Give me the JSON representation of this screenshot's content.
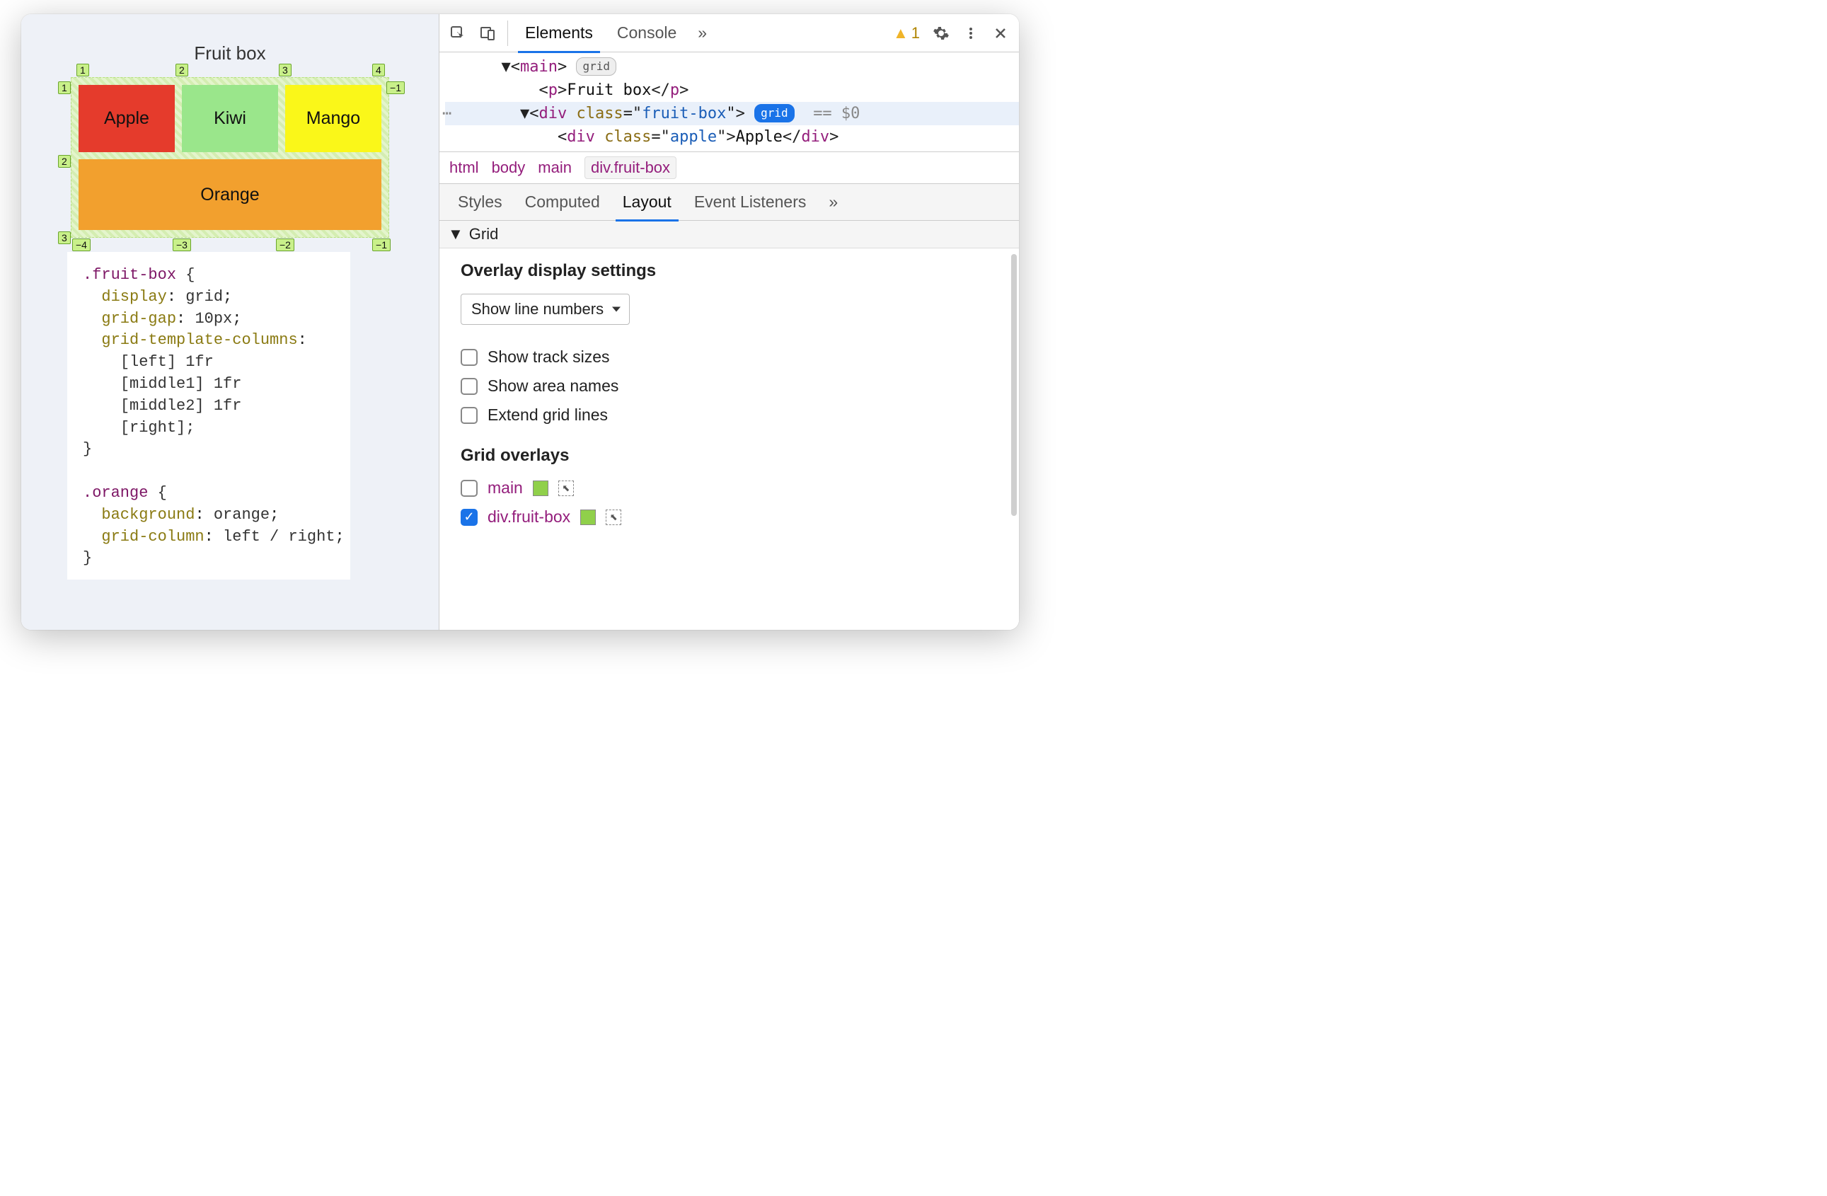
{
  "viewport": {
    "title": "Fruit box",
    "cells": {
      "apple": "Apple",
      "kiwi": "Kiwi",
      "mango": "Mango",
      "orange": "Orange"
    },
    "grid_lines": {
      "top": [
        "1",
        "2",
        "3",
        "4"
      ],
      "bottom": [
        "−4",
        "−3",
        "−2",
        "−1"
      ],
      "left": [
        "1",
        "2",
        "3"
      ],
      "right": [
        "−1"
      ]
    },
    "css": {
      "sel1": ".fruit-box",
      "rules1": [
        {
          "prop": "display",
          "val": "grid"
        },
        {
          "prop": "grid-gap",
          "val": "10px"
        },
        {
          "prop": "grid-template-columns",
          "val": ""
        }
      ],
      "tmpl_lines": [
        "[left] 1fr",
        "[middle1] 1fr",
        "[middle2] 1fr",
        "[right];"
      ],
      "sel2": ".orange",
      "rules2": [
        {
          "prop": "background",
          "val": "orange"
        },
        {
          "prop": "grid-column",
          "val": "left / right"
        }
      ]
    }
  },
  "devtools": {
    "tabs": {
      "elements": "Elements",
      "console": "Console",
      "more": "»"
    },
    "warning_count": "1",
    "dom": {
      "main_tag": "main",
      "main_badge": "grid",
      "p_text": "Fruit box",
      "div_tag": "div",
      "div_class_attr": "class",
      "div_class_val": "fruit-box",
      "div_badge": "grid",
      "eq0": "== $0",
      "child_class_val": "apple",
      "child_text": "Apple"
    },
    "crumbs": [
      "html",
      "body",
      "main",
      "div.fruit-box"
    ],
    "subtabs": {
      "styles": "Styles",
      "computed": "Computed",
      "layout": "Layout",
      "listeners": "Event Listeners",
      "more": "»"
    },
    "grid_section": {
      "header": "Grid",
      "overlay_title": "Overlay display settings",
      "select_value": "Show line numbers",
      "checks": {
        "track_sizes": "Show track sizes",
        "area_names": "Show area names",
        "extend_lines": "Extend grid lines"
      },
      "overlays_title": "Grid overlays",
      "overlays": [
        {
          "name": "main",
          "checked": false,
          "swatch": "#90d04a"
        },
        {
          "name": "div.fruit-box",
          "checked": true,
          "swatch": "#90d04a"
        }
      ]
    }
  }
}
